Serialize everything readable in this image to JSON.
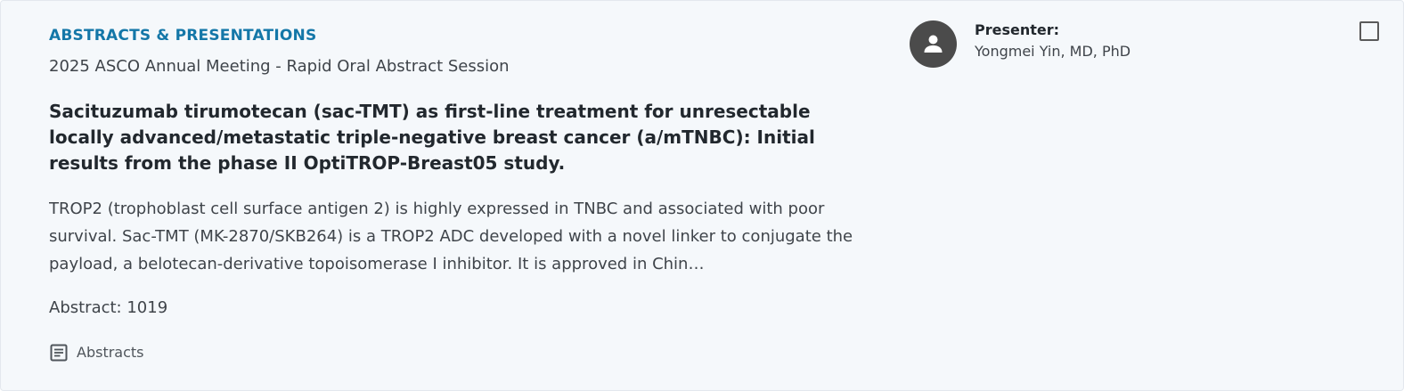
{
  "card": {
    "category": "ABSTRACTS & PRESENTATIONS",
    "meeting": "2025 ASCO Annual Meeting - Rapid Oral Abstract Session",
    "title": "Sacituzumab tirumotecan (sac-TMT) as first-line treatment for unresectable locally advanced/metastatic triple-negative breast cancer (a/mTNBC): Initial results from the phase II OptiTROP-Breast05 study.",
    "body": "TROP2 (trophoblast cell surface antigen 2) is highly expressed in TNBC and associated with poor survival. Sac-TMT (MK-2870/SKB264) is a TROP2 ADC developed with a novel linker to conjugate the payload, a belotecan-derivative topoisomerase I inhibitor. It is approved in Chin…",
    "abstract_number": "Abstract: 1019",
    "abstracts_link": "Abstracts",
    "abstracts_icon": "document-icon"
  },
  "presenter": {
    "label": "Presenter:",
    "name": "Yongmei Yin, MD, PhD",
    "avatar_icon": "person-icon"
  },
  "select_checkbox": {
    "checked": false,
    "icon": "checkbox-icon"
  },
  "colors": {
    "accent": "#1477a8",
    "card_background": "#f5f8fb",
    "avatar": "#4b4b4b",
    "title": "#22282e",
    "body": "#3f444a"
  }
}
